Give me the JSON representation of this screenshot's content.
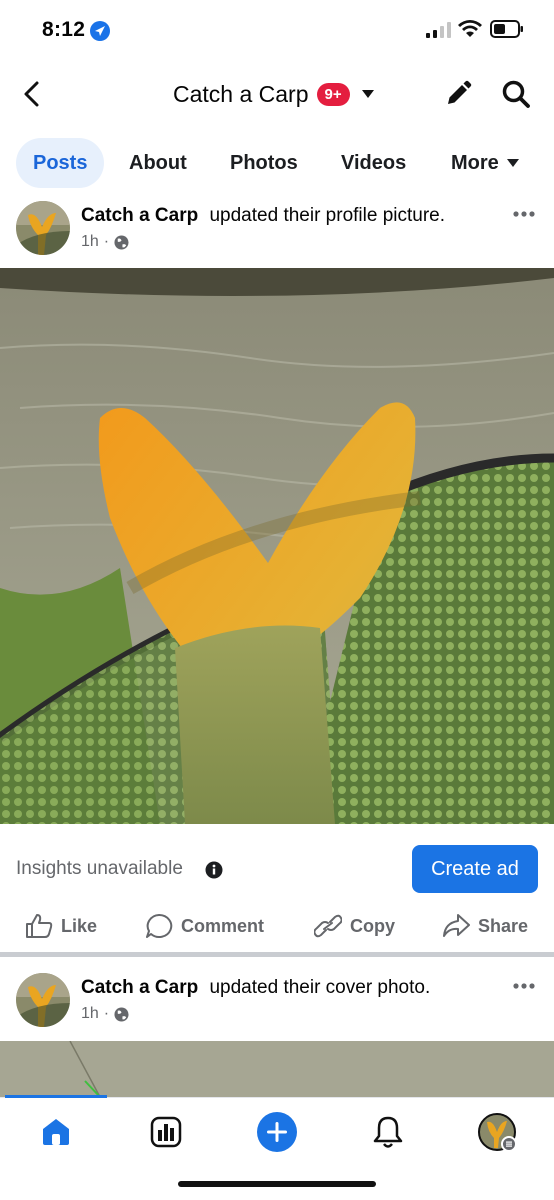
{
  "status_bar": {
    "time": "8:12"
  },
  "header": {
    "page_name": "Catch a Carp",
    "badge": "9+"
  },
  "tabs": [
    {
      "label": "Posts",
      "active": true
    },
    {
      "label": "About"
    },
    {
      "label": "Photos"
    },
    {
      "label": "Videos"
    },
    {
      "label": "More"
    }
  ],
  "posts": [
    {
      "author": "Catch a Carp",
      "action": "updated their profile picture.",
      "time": "1h",
      "dot": "·"
    },
    {
      "author": "Catch a Carp",
      "action": "updated their cover photo.",
      "time": "1h",
      "dot": "·"
    }
  ],
  "insights": {
    "text": "Insights unavailable",
    "create_ad": "Create ad"
  },
  "actions": {
    "like": "Like",
    "comment": "Comment",
    "copy": "Copy",
    "share": "Share"
  },
  "icons": {
    "back": "back-chevron-icon",
    "caret": "caret-down-icon",
    "edit": "pencil-icon",
    "search": "search-icon",
    "globe": "globe-icon",
    "more": "more-dots-icon",
    "info": "info-icon",
    "home": "home-icon",
    "insights": "insights-icon",
    "create": "plus-icon",
    "notifications": "bell-icon"
  },
  "colors": {
    "accent": "#1b74e4",
    "badge": "#e41e3f",
    "tab_active_bg": "#e7f0fc"
  }
}
